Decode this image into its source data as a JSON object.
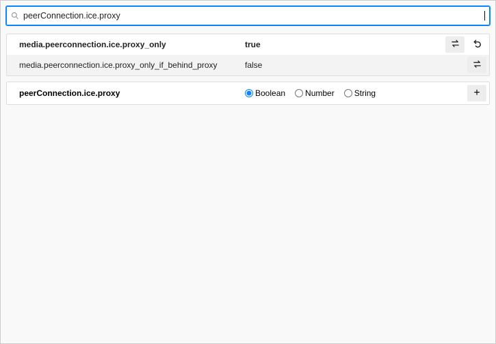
{
  "search": {
    "value": "peerConnection.ice.proxy",
    "placeholder": ""
  },
  "prefs": [
    {
      "name": "media.peerconnection.ice.proxy_only",
      "value": "true",
      "modified": true,
      "has_reset": true
    },
    {
      "name": "media.peerconnection.ice.proxy_only_if_behind_proxy",
      "value": "false",
      "modified": false,
      "has_reset": false
    }
  ],
  "add_pref": {
    "name": "peerConnection.ice.proxy",
    "types": [
      "Boolean",
      "Number",
      "String"
    ],
    "selected_type": "Boolean",
    "button_label": "+"
  }
}
